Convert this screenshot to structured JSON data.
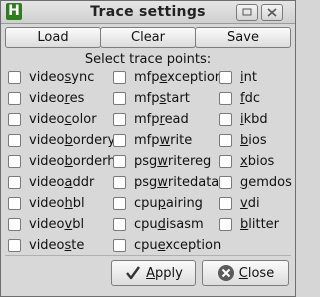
{
  "window": {
    "title": "Trace settings",
    "icon_letter": "H"
  },
  "toolbar": {
    "load": "Load",
    "clear": "Clear",
    "save": "Save"
  },
  "section_label": "Select trace points:",
  "columns": [
    [
      {
        "pre": "video",
        "ul": "s",
        "post": "ync",
        "checked": false
      },
      {
        "pre": "video",
        "ul": "r",
        "post": "es",
        "checked": false
      },
      {
        "pre": "video",
        "ul": "c",
        "post": "olor",
        "checked": false
      },
      {
        "pre": "video",
        "ul": "b",
        "post": "ordery",
        "checked": false
      },
      {
        "pre": "video",
        "ul": "b",
        "post": "orderh",
        "checked": false
      },
      {
        "pre": "video",
        "ul": "a",
        "post": "ddr",
        "checked": false
      },
      {
        "pre": "video",
        "ul": "h",
        "post": "bl",
        "checked": false
      },
      {
        "pre": "video",
        "ul": "v",
        "post": "bl",
        "checked": false
      },
      {
        "pre": "video",
        "ul": "s",
        "post": "te",
        "checked": false
      }
    ],
    [
      {
        "pre": "mfp",
        "ul": "e",
        "post": "xception",
        "checked": false
      },
      {
        "pre": "mfp",
        "ul": "s",
        "post": "tart",
        "checked": false
      },
      {
        "pre": "mfp",
        "ul": "r",
        "post": "ead",
        "checked": false
      },
      {
        "pre": "mfp",
        "ul": "w",
        "post": "rite",
        "checked": false
      },
      {
        "pre": "psg",
        "ul": "w",
        "post": "ritereg",
        "checked": false
      },
      {
        "pre": "psg",
        "ul": "w",
        "post": "ritedata",
        "checked": false
      },
      {
        "pre": "cpu",
        "ul": "p",
        "post": "airing",
        "checked": false
      },
      {
        "pre": "cpu",
        "ul": "d",
        "post": "isasm",
        "checked": false
      },
      {
        "pre": "cpu",
        "ul": "e",
        "post": "xception",
        "checked": false
      }
    ],
    [
      {
        "pre": "",
        "ul": "i",
        "post": "nt",
        "checked": false
      },
      {
        "pre": "",
        "ul": "f",
        "post": "dc",
        "checked": false
      },
      {
        "pre": "",
        "ul": "i",
        "post": "kbd",
        "checked": false
      },
      {
        "pre": "",
        "ul": "b",
        "post": "ios",
        "checked": false
      },
      {
        "pre": "",
        "ul": "x",
        "post": "bios",
        "checked": false
      },
      {
        "pre": "",
        "ul": "g",
        "post": "emdos",
        "checked": false
      },
      {
        "pre": "",
        "ul": "v",
        "post": "di",
        "checked": false
      },
      {
        "pre": "",
        "ul": "b",
        "post": "litter",
        "checked": false
      }
    ]
  ],
  "footer": {
    "apply": {
      "ul": "A",
      "post": "pply",
      "icon": "checkmark-icon"
    },
    "close": {
      "ul": "C",
      "post": "lose",
      "icon": "close-icon"
    }
  },
  "colors": {
    "apply_icon": "#333333",
    "close_icon_bg": "#5a5a5a"
  }
}
